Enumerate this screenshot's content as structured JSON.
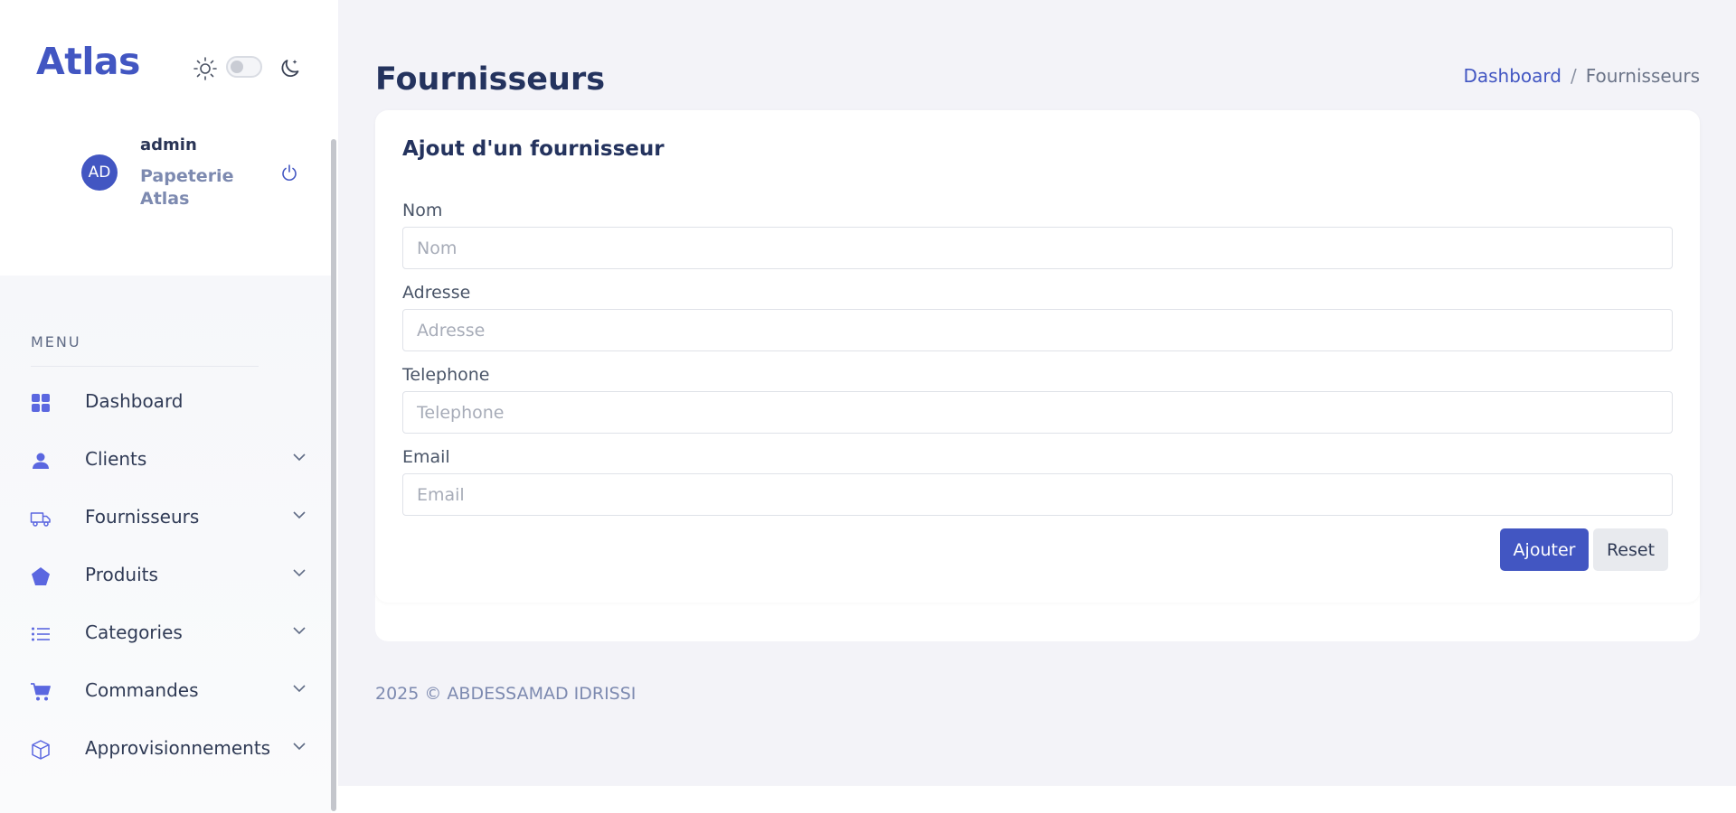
{
  "brand": {
    "name": "Atlas"
  },
  "theme": {
    "icons": [
      "sun-icon",
      "moon-icon"
    ],
    "mode": "light"
  },
  "user": {
    "avatar_initials": "AD",
    "name": "admin",
    "company": "Papeterie Atlas"
  },
  "sidebar": {
    "menu_title": "MENU",
    "items": [
      {
        "label": "Dashboard",
        "icon": "grid-icon",
        "expandable": false
      },
      {
        "label": "Clients",
        "icon": "user-icon",
        "expandable": true
      },
      {
        "label": "Fournisseurs",
        "icon": "truck-icon",
        "expandable": true
      },
      {
        "label": "Produits",
        "icon": "pentagon-icon",
        "expandable": true
      },
      {
        "label": "Categories",
        "icon": "list-icon",
        "expandable": true
      },
      {
        "label": "Commandes",
        "icon": "cart-icon",
        "expandable": true
      },
      {
        "label": "Approvisionnements",
        "icon": "box-icon",
        "expandable": true
      }
    ]
  },
  "header": {
    "title": "Fournisseurs",
    "breadcrumb": {
      "link": "Dashboard",
      "separator": "/",
      "current": "Fournisseurs"
    }
  },
  "form": {
    "title": "Ajout d'un fournisseur",
    "fields": [
      {
        "label": "Nom",
        "placeholder": "Nom",
        "value": ""
      },
      {
        "label": "Adresse",
        "placeholder": "Adresse",
        "value": ""
      },
      {
        "label": "Telephone",
        "placeholder": "Telephone",
        "value": ""
      },
      {
        "label": "Email",
        "placeholder": "Email",
        "value": ""
      }
    ],
    "submit_label": "Ajouter",
    "reset_label": "Reset"
  },
  "footer": {
    "text": "2025 © ABDESSAMAD IDRISSI"
  },
  "colors": {
    "accent": "#4256c2",
    "icon_purple": "#5b67e0",
    "background": "#f3f3f8",
    "heading": "#24335e"
  }
}
